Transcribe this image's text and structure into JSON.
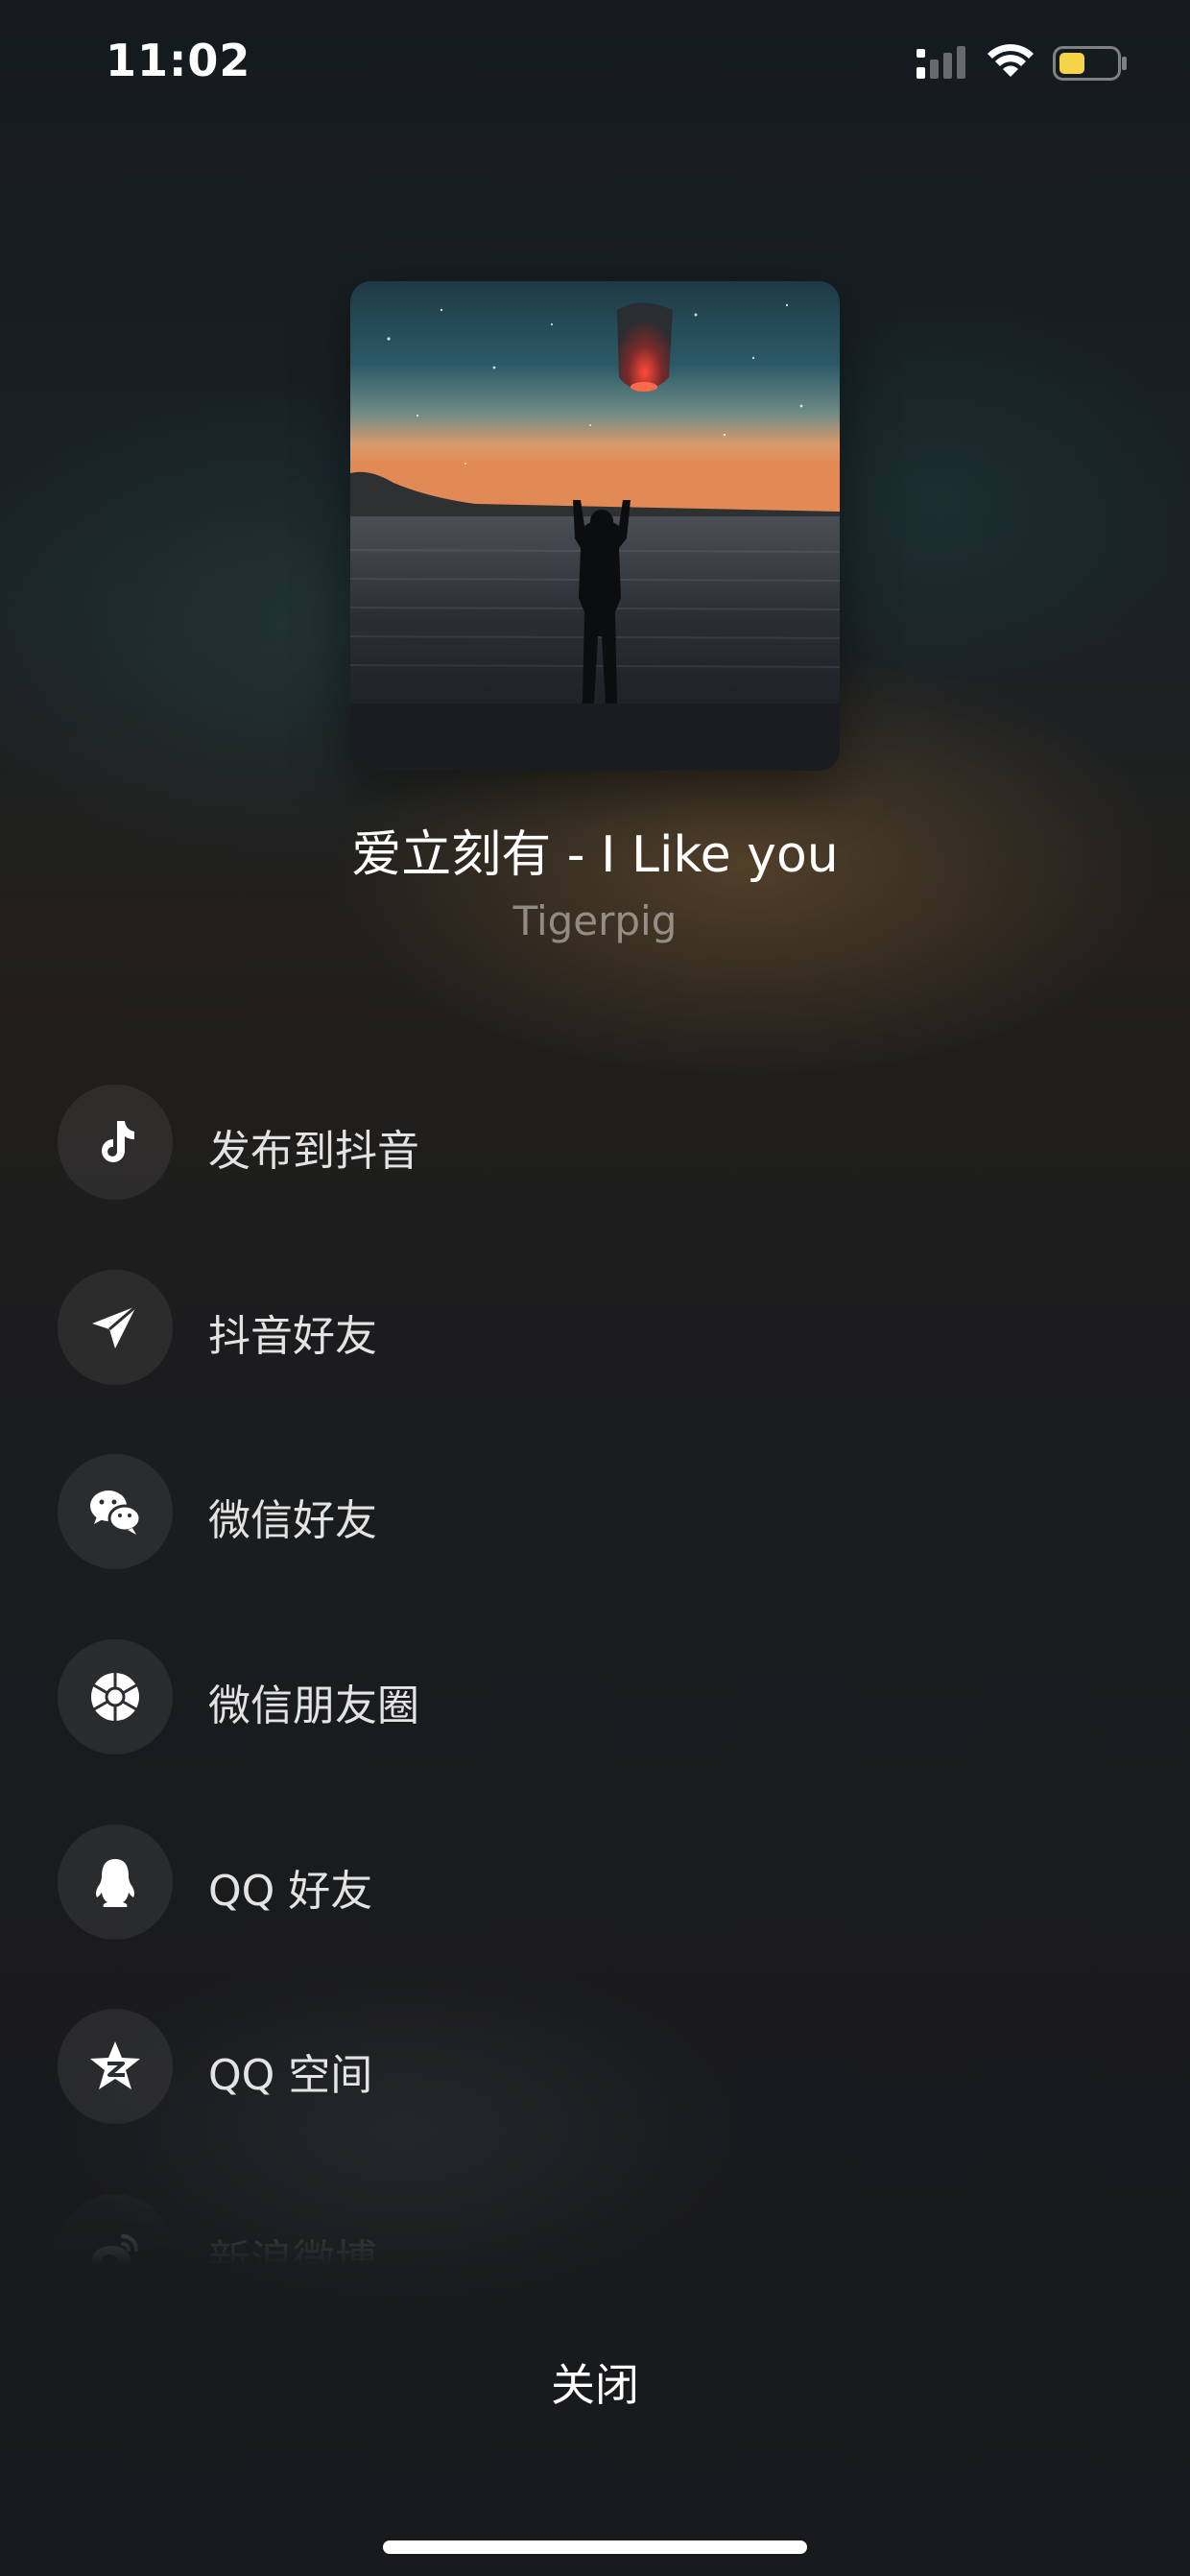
{
  "status_bar": {
    "time": "11:02",
    "signal_icon": "cellular-signal-icon",
    "wifi_icon": "wifi-icon",
    "battery_icon": "battery-low-icon",
    "battery_color": "#f5d547"
  },
  "song": {
    "title": "爱立刻有 - I Like you",
    "artist": "Tigerpig"
  },
  "share_options": [
    {
      "label": "发布到抖音",
      "icon": "douyin-icon"
    },
    {
      "label": "抖音好友",
      "icon": "paper-plane-icon"
    },
    {
      "label": "微信好友",
      "icon": "wechat-icon"
    },
    {
      "label": "微信朋友圈",
      "icon": "wechat-moments-icon"
    },
    {
      "label": "QQ 好友",
      "icon": "qq-icon"
    },
    {
      "label": "QQ 空间",
      "icon": "qzone-icon"
    },
    {
      "label": "新浪微博",
      "icon": "weibo-icon"
    }
  ],
  "close_label": "关闭"
}
